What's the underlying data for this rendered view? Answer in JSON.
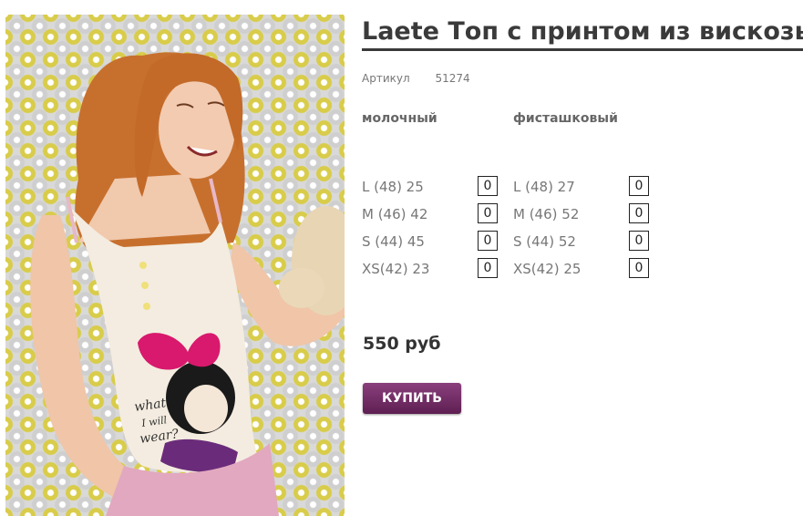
{
  "product": {
    "title": "Laete Топ с принтом из вискозы",
    "article_label": "Артикул",
    "article_value": "51274",
    "colors": [
      {
        "name": "молочный",
        "sizes": [
          {
            "label": "L (48)   25",
            "qty": "0"
          },
          {
            "label": "M (46)   42",
            "qty": "0"
          },
          {
            "label": "S (44)   45",
            "qty": "0"
          },
          {
            "label": "XS(42)   23",
            "qty": "0"
          }
        ]
      },
      {
        "name": "фисташковый",
        "sizes": [
          {
            "label": "L (48)   27",
            "qty": "0"
          },
          {
            "label": "M (46)   52",
            "qty": "0"
          },
          {
            "label": "S (44)   52",
            "qty": "0"
          },
          {
            "label": "XS(42)   25",
            "qty": "0"
          }
        ]
      }
    ],
    "price": "550 руб",
    "buy_label": "КУПИТЬ",
    "buy_color": "#6e2a63"
  },
  "image": {
    "shirt_print_text": "what I will wear?"
  }
}
